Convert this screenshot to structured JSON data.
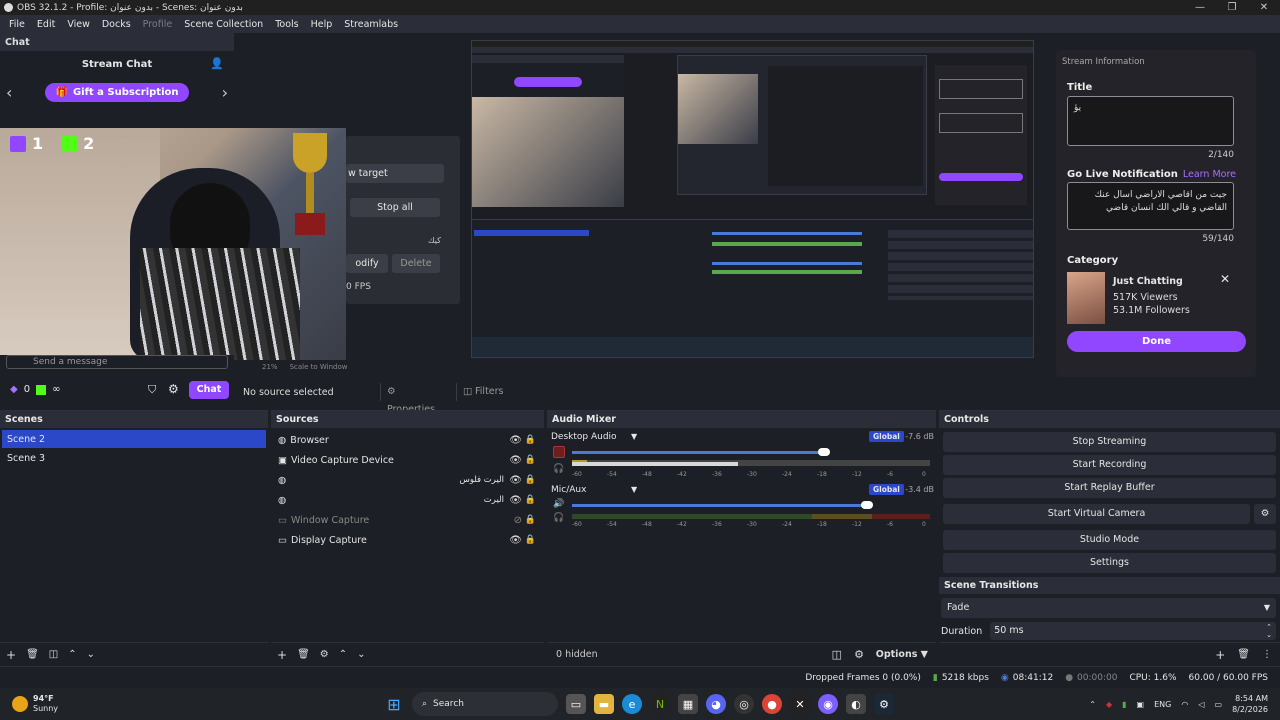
{
  "titlebar": {
    "title": "OBS 32.1.2 - Profile: بدون عنوان - Scenes: بدون عنوان",
    "min": "—",
    "max": "❐",
    "close": "✕"
  },
  "menu": [
    "File",
    "Edit",
    "View",
    "Docks",
    "Profile",
    "Scene Collection",
    "Tools",
    "Help",
    "Streamlabs"
  ],
  "chat": {
    "dock_title": "Chat",
    "header": "Stream Chat",
    "gift_button": "Gift a Subscription",
    "left_arrow": "‹",
    "right_arrow": "›",
    "send_placeholder": "Send a message",
    "chat_button": "Chat",
    "count1": "0",
    "count2": "∞"
  },
  "overlay": {
    "twitch_count": "1",
    "kick_count": "2"
  },
  "stream_manager": {
    "new_target": "w target",
    "stop_all": "Stop all",
    "modify": "odify",
    "delete": "Delete",
    "fps": "0 FPS",
    "label": "كيك"
  },
  "preview": {
    "zoom": "21%",
    "scale": "Scale to Window"
  },
  "stream_info": {
    "header": "Stream Information",
    "title_label": "Title",
    "title_value": "يؤ",
    "title_count": "2/140",
    "golive_label": "Go Live Notification",
    "learn_more": "Learn More",
    "golive_value": "جيت من اقاصي الاراضي اسال عنك القاضي و قالي الك انسان قاضي",
    "golive_count": "59/140",
    "category_label": "Category",
    "category_name": "Just Chatting",
    "viewers": "517K Viewers",
    "followers": "53.1M Followers",
    "done": "Done"
  },
  "source_bar": {
    "no_source": "No source selected",
    "properties": "Properties",
    "filters": "Filters"
  },
  "scenes": {
    "title": "Scenes",
    "items": [
      "Scene 2",
      "Scene 3"
    ]
  },
  "sources": {
    "title": "Sources",
    "items": [
      {
        "name": "Browser",
        "visible": true
      },
      {
        "name": "Video Capture Device",
        "visible": true
      },
      {
        "name": "",
        "label_rtl": "اليرت فلوس",
        "visible": true
      },
      {
        "name": "",
        "label_rtl": "اليرت",
        "visible": true
      },
      {
        "name": "Window Capture",
        "visible": false
      },
      {
        "name": "Display Capture",
        "visible": true
      }
    ]
  },
  "audio": {
    "title": "Audio Mixer",
    "channels": [
      {
        "name": "Desktop Audio",
        "badge": "Global",
        "db": "-7.6 dB"
      },
      {
        "name": "Mic/Aux",
        "badge": "Global",
        "db": "-3.4 dB"
      }
    ],
    "ticks": [
      "-60",
      "-54",
      "-48",
      "-42",
      "-36",
      "-30",
      "-24",
      "-18",
      "-12",
      "-6",
      "0"
    ],
    "hidden": "0 hidden",
    "options": "Options"
  },
  "controls": {
    "title": "Controls",
    "buttons": [
      "Stop Streaming",
      "Start Recording",
      "Start Replay Buffer",
      "Start Virtual Camera",
      "Studio Mode",
      "Settings"
    ]
  },
  "transitions": {
    "title": "Scene Transitions",
    "value": "Fade",
    "duration_label": "Duration",
    "duration_value": "50 ms"
  },
  "status": {
    "dropped": "Dropped Frames 0 (0.0%)",
    "kbps": "5218 kbps",
    "stream_time": "08:41:12",
    "rec_time": "00:00:00",
    "cpu": "CPU: 1.6%",
    "fps": "60.00 / 60.00 FPS"
  },
  "taskbar": {
    "temp": "94°F",
    "weather": "Sunny",
    "search": "Search",
    "lang": "ENG",
    "time": "8:54 AM",
    "date": "8/2/2026"
  },
  "colors": {
    "accent": "#9146ff",
    "scene_selected": "#2b48c8",
    "meter_green": "#5aa84c",
    "meter_yellow": "#b59b2b",
    "meter_red": "#9b2a2a"
  }
}
